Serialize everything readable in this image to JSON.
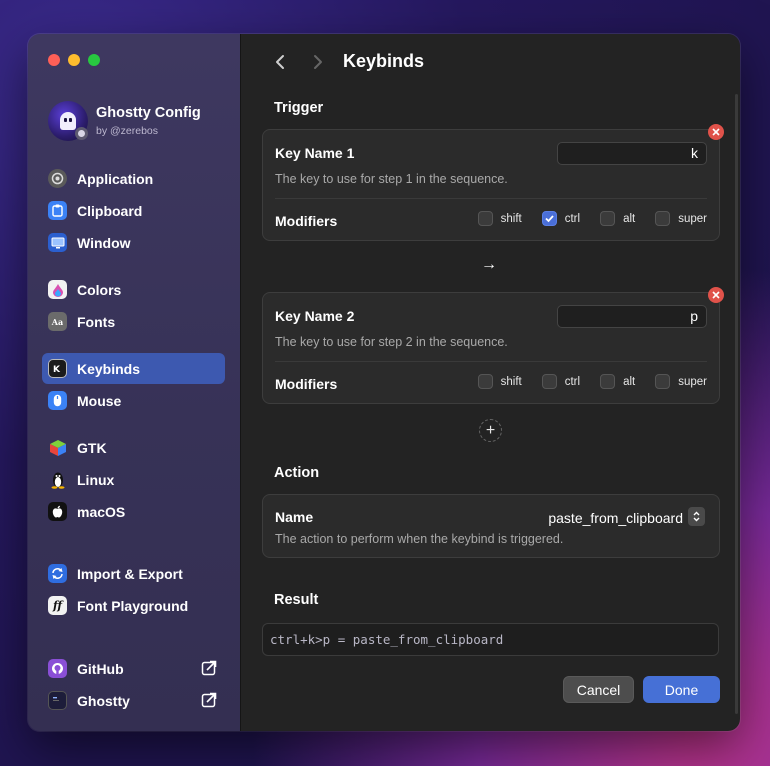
{
  "app": {
    "title": "Ghostty Config",
    "subtitle": "by @zerebos"
  },
  "sidebar": {
    "items": [
      {
        "label": "Application",
        "icon": "application-icon"
      },
      {
        "label": "Clipboard",
        "icon": "clipboard-icon"
      },
      {
        "label": "Window",
        "icon": "window-icon"
      },
      {
        "label": "Colors",
        "icon": "colors-icon"
      },
      {
        "label": "Fonts",
        "icon": "fonts-icon"
      },
      {
        "label": "Keybinds",
        "icon": "keybinds-icon",
        "active": true
      },
      {
        "label": "Mouse",
        "icon": "mouse-icon"
      },
      {
        "label": "GTK",
        "icon": "gtk-icon"
      },
      {
        "label": "Linux",
        "icon": "linux-icon"
      },
      {
        "label": "macOS",
        "icon": "apple-icon"
      },
      {
        "label": "Import & Export",
        "icon": "import-export-icon"
      },
      {
        "label": "Font Playground",
        "icon": "font-playground-icon"
      },
      {
        "label": "GitHub",
        "icon": "github-icon",
        "external": true
      },
      {
        "label": "Ghostty",
        "icon": "ghostty-icon",
        "external": true
      }
    ]
  },
  "header": {
    "title": "Keybinds"
  },
  "trigger": {
    "title": "Trigger",
    "steps": [
      {
        "key_label": "Key Name 1",
        "key_value": "k",
        "description": "The key to use for step 1 in the sequence.",
        "modifiers_label": "Modifiers",
        "modifiers": [
          {
            "label": "shift",
            "checked": false
          },
          {
            "label": "ctrl",
            "checked": true
          },
          {
            "label": "alt",
            "checked": false
          },
          {
            "label": "super",
            "checked": false
          }
        ]
      },
      {
        "key_label": "Key Name 2",
        "key_value": "p",
        "description": "The key to use for step 2 in the sequence.",
        "modifiers_label": "Modifiers",
        "modifiers": [
          {
            "label": "shift",
            "checked": false
          },
          {
            "label": "ctrl",
            "checked": false
          },
          {
            "label": "alt",
            "checked": false
          },
          {
            "label": "super",
            "checked": false
          }
        ]
      }
    ],
    "separator": "→",
    "add": "+"
  },
  "action": {
    "title": "Action",
    "name_label": "Name",
    "name_value": "paste_from_clipboard",
    "description": "The action to perform when the keybind is triggered."
  },
  "result": {
    "title": "Result",
    "value": "ctrl+k>p = paste_from_clipboard"
  },
  "buttons": {
    "cancel": "Cancel",
    "done": "Done"
  },
  "colors": {
    "accent": "#4670d6",
    "remove": "#e0524a",
    "sidebar_active": "#3d59b0"
  }
}
